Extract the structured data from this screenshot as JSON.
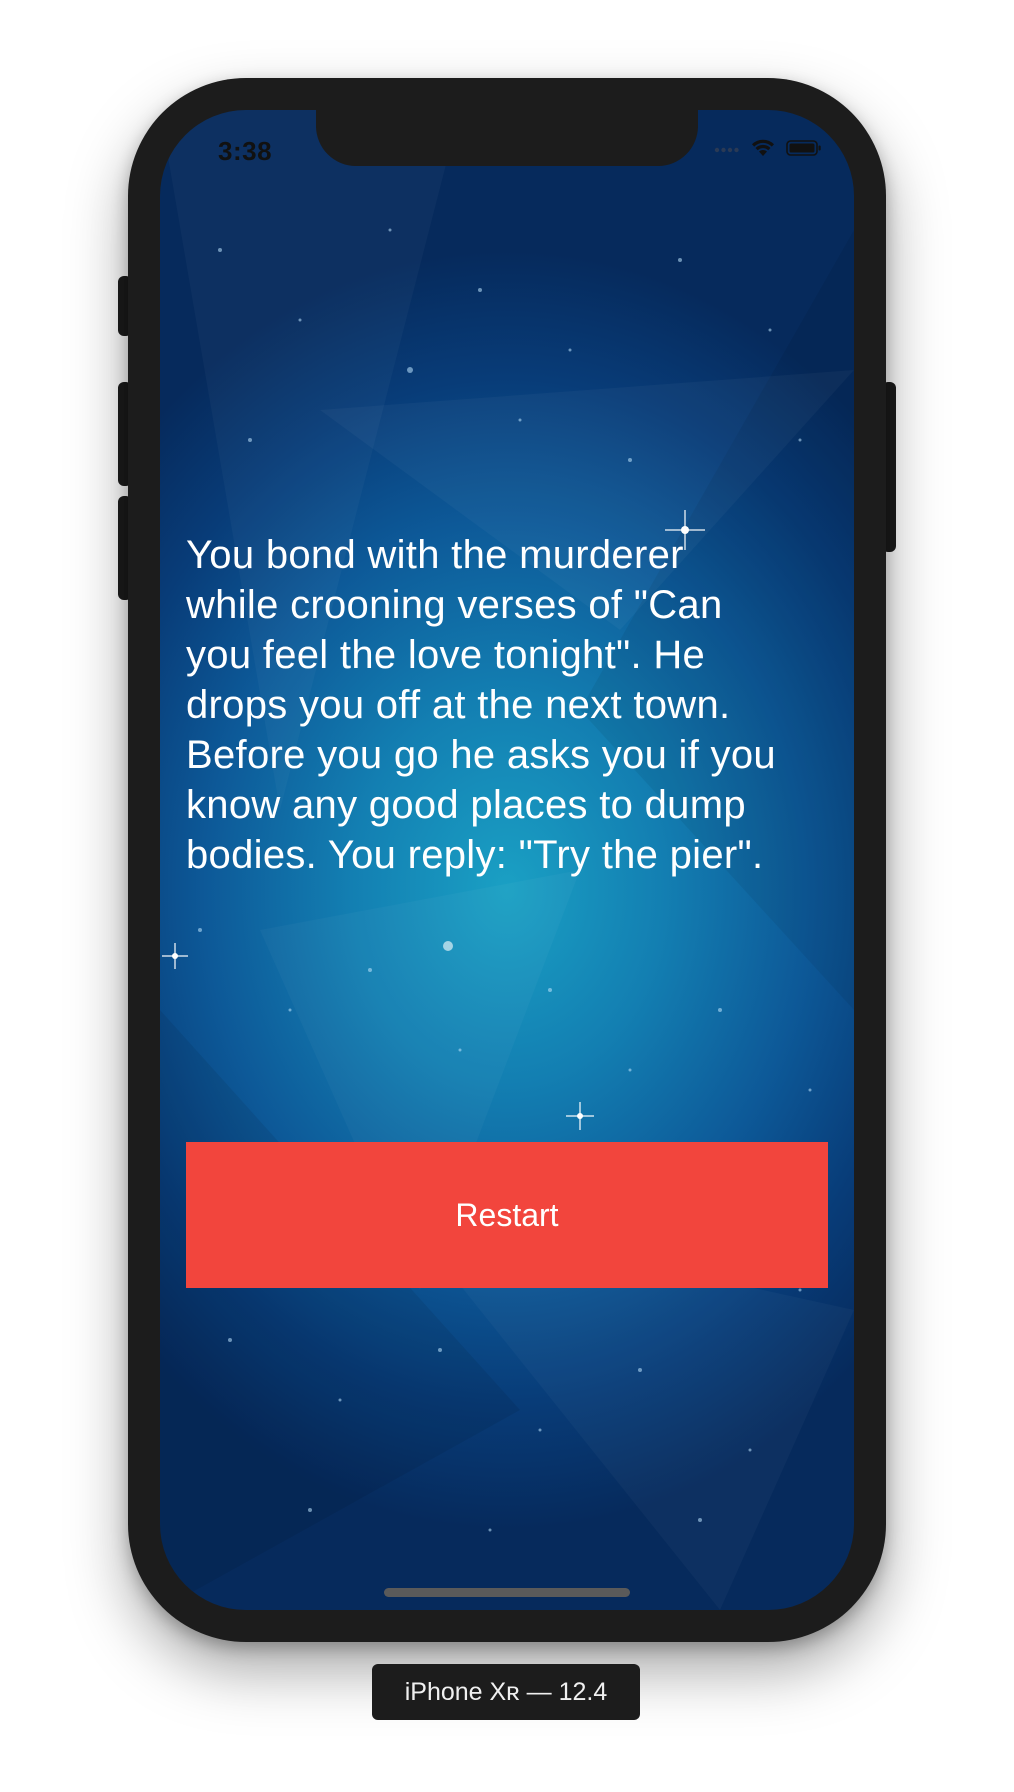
{
  "status_bar": {
    "time": "3:38",
    "icons": [
      "cellular-icon",
      "wifi-icon",
      "battery-icon"
    ]
  },
  "story": {
    "text": "You bond with the murderer\nwhile crooning verses of \"Can\nyou feel the love tonight\". He\ndrops you off at the next town.\nBefore you go he asks you if you\nknow any good places to dump\nbodies. You reply: \"Try the pier\"."
  },
  "actions": {
    "restart_label": "Restart"
  },
  "device": {
    "label": "iPhone Xʀ — 12.4"
  },
  "colors": {
    "restart_button": "#f2453d",
    "background_center": "#1aa0c4",
    "background_edge": "#062a5c",
    "device_frame": "#1c1c1c"
  }
}
